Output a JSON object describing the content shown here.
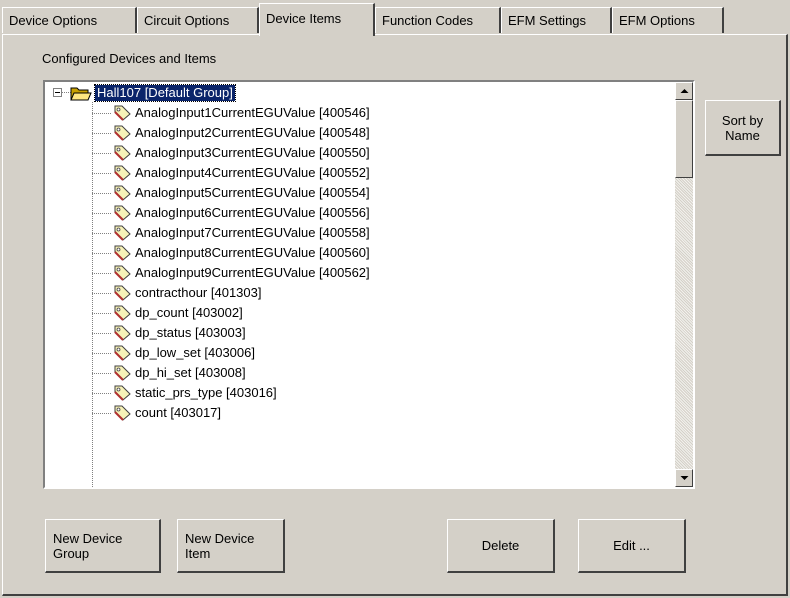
{
  "tabs": [
    {
      "label": "Device Options",
      "active": false
    },
    {
      "label": "Circuit Options",
      "active": false
    },
    {
      "label": "Device Items",
      "active": true
    },
    {
      "label": "Function Codes",
      "active": false
    },
    {
      "label": "EFM Settings",
      "active": false
    },
    {
      "label": "EFM Options",
      "active": false
    }
  ],
  "panel": {
    "group_label": "Configured Devices and Items"
  },
  "tree": {
    "root_label": "Hall107 [Default Group]",
    "items": [
      "AnalogInput1CurrentEGUValue  [400546]",
      "AnalogInput2CurrentEGUValue  [400548]",
      "AnalogInput3CurrentEGUValue  [400550]",
      "AnalogInput4CurrentEGUValue  [400552]",
      "AnalogInput5CurrentEGUValue  [400554]",
      "AnalogInput6CurrentEGUValue  [400556]",
      "AnalogInput7CurrentEGUValue  [400558]",
      "AnalogInput8CurrentEGUValue  [400560]",
      "AnalogInput9CurrentEGUValue  [400562]",
      "contracthour  [401303]",
      "dp_count  [403002]",
      "dp_status  [403003]",
      "dp_low_set  [403006]",
      "dp_hi_set  [403008]",
      "static_prs_type  [403016]",
      "count  [403017]"
    ]
  },
  "buttons": {
    "sort_by_name": "Sort by\nName",
    "new_device_group": "New Device\nGroup",
    "new_device_item": "New Device\nItem",
    "delete": "Delete",
    "edit": "Edit ..."
  },
  "colors": {
    "face": "#d4d0c8",
    "selection": "#0a246a",
    "tree_background": "#ffffff"
  },
  "icons": {
    "folder": "open-folder-icon",
    "item": "tag-icon",
    "expander": "collapse-minus-icon"
  }
}
